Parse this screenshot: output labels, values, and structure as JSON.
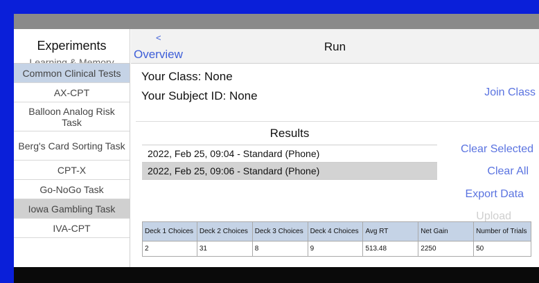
{
  "sidebar": {
    "title": "Experiments",
    "peek_label": "Learning & Memory",
    "items": [
      {
        "label": "Common Clinical Tests",
        "kind": "category"
      },
      {
        "label": "AX-CPT",
        "kind": "item"
      },
      {
        "label": "Balloon Analog Risk Task",
        "kind": "item"
      },
      {
        "label": "Berg's Card Sorting Task",
        "kind": "item"
      },
      {
        "label": "CPT-X",
        "kind": "item"
      },
      {
        "label": "Go-NoGo Task",
        "kind": "item"
      },
      {
        "label": "Iowa Gambling Task",
        "kind": "selected"
      },
      {
        "label": "IVA-CPT",
        "kind": "item"
      }
    ]
  },
  "nav": {
    "back_chevron": "<",
    "back_label": "Overview",
    "title": "Run"
  },
  "main": {
    "class_line": "Your Class: None",
    "subject_line": "Your Subject ID: None",
    "join_class": "Join Class",
    "results_title": "Results",
    "results": [
      {
        "label": "2022, Feb 25, 09:04 - Standard (Phone)",
        "selected": false
      },
      {
        "label": "2022, Feb 25, 09:06 - Standard (Phone)",
        "selected": true
      }
    ],
    "actions": {
      "clear_selected": "Clear Selected",
      "clear_all": "Clear All",
      "export_data": "Export Data",
      "upload": "Upload"
    },
    "table": {
      "headers": [
        "Deck 1 Choices",
        "Deck 2 Choices",
        "Deck 3 Choices",
        "Deck 4 Choices",
        "Avg RT",
        "Net Gain",
        "Number of Trials"
      ],
      "rows": [
        [
          "2",
          "31",
          "8",
          "9",
          "513.48",
          "2250",
          "50"
        ]
      ]
    }
  },
  "colors": {
    "frame": "#0a1fd9",
    "accent": "#5a73e0",
    "category_bg": "#c5d3e6",
    "selected_bg": "#d0d0d0"
  }
}
